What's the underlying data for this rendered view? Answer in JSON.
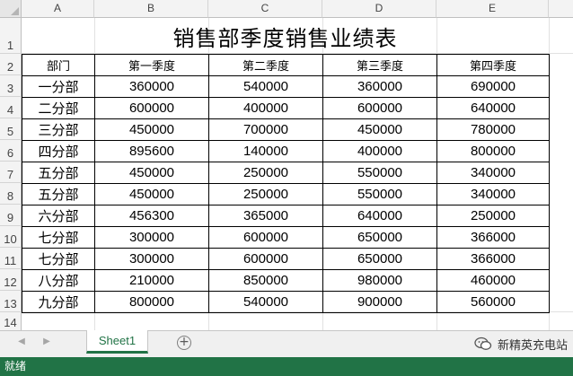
{
  "columns": [
    "A",
    "B",
    "C",
    "D",
    "E"
  ],
  "rows": [
    "1",
    "2",
    "3",
    "4",
    "5",
    "6",
    "7",
    "8",
    "9",
    "10",
    "11",
    "12",
    "13",
    "14"
  ],
  "title": "销售部季度销售业绩表",
  "table_headers": [
    "部门",
    "第一季度",
    "第二季度",
    "第三季度",
    "第四季度"
  ],
  "table_rows": [
    [
      "一分部",
      "360000",
      "540000",
      "360000",
      "690000"
    ],
    [
      "二分部",
      "600000",
      "400000",
      "600000",
      "640000"
    ],
    [
      "三分部",
      "450000",
      "700000",
      "450000",
      "780000"
    ],
    [
      "四分部",
      "895600",
      "140000",
      "400000",
      "800000"
    ],
    [
      "五分部",
      "450000",
      "250000",
      "550000",
      "340000"
    ],
    [
      "五分部",
      "450000",
      "250000",
      "550000",
      "340000"
    ],
    [
      "六分部",
      "456300",
      "365000",
      "640000",
      "250000"
    ],
    [
      "七分部",
      "300000",
      "600000",
      "650000",
      "366000"
    ],
    [
      "七分部",
      "300000",
      "600000",
      "650000",
      "366000"
    ],
    [
      "八分部",
      "210000",
      "850000",
      "980000",
      "460000"
    ],
    [
      "九分部",
      "800000",
      "540000",
      "900000",
      "560000"
    ]
  ],
  "tabbar": {
    "sheet_name": "Sheet1",
    "add_sheet": "+",
    "prev": "◀",
    "next": "▶",
    "watermark": "新精英充电站"
  },
  "status": "就绪",
  "colors": {
    "accent": "#217346",
    "gridline": "#e1e1e1",
    "header_bg": "#f3f3f3"
  },
  "icons": [
    "select-all-triangle-icon",
    "scroll-left-icon",
    "scroll-right-icon",
    "add-sheet-icon",
    "wechat-logo-icon"
  ]
}
